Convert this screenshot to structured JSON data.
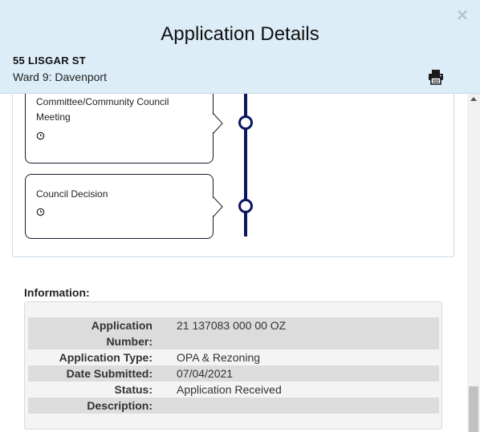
{
  "header": {
    "title": "Application Details",
    "close_symbol": "×",
    "address": "55 LISGAR ST",
    "ward": "Ward 9: Davenport",
    "print_icon": "printer-icon"
  },
  "timeline": {
    "stages": [
      {
        "label": "Committee/Community Council Meeting",
        "icon": "clock-icon"
      },
      {
        "label": "Council Decision",
        "icon": "clock-icon"
      }
    ]
  },
  "information": {
    "heading": "Information:",
    "rows": [
      {
        "key": "Application Number:",
        "value": "21 137083 000 00 OZ"
      },
      {
        "key": "Application Type:",
        "value": "OPA & Rezoning"
      },
      {
        "key": "Date Submitted:",
        "value": "07/04/2021"
      },
      {
        "key": "Status:",
        "value": "Application Received"
      },
      {
        "key": "Description:",
        "value": ""
      }
    ]
  },
  "colors": {
    "header_bg": "#dcedf7",
    "timeline": "#0b1560"
  }
}
